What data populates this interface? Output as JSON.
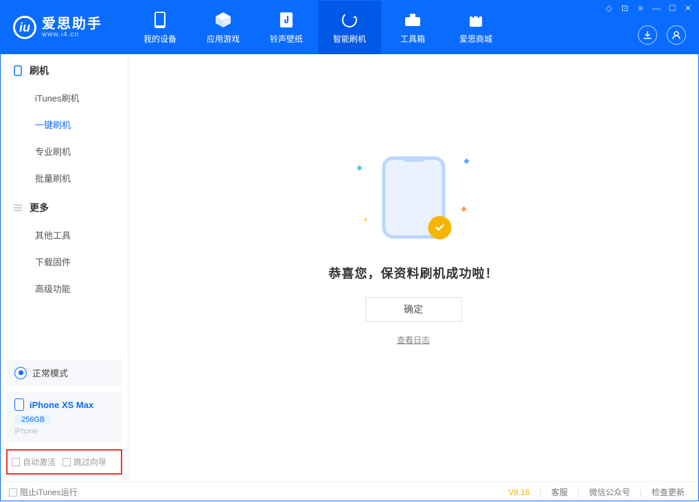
{
  "app": {
    "name_cn": "爱思助手",
    "name_en": "www.i4.cn"
  },
  "nav": {
    "my_device": "我的设备",
    "apps_games": "应用游戏",
    "ringtones": "铃声壁纸",
    "smart_flash": "智能刷机",
    "toolbox": "工具箱",
    "store": "爱思商城"
  },
  "sidebar": {
    "group_flash_title": "刷机",
    "items_flash": {
      "itunes": "iTunes刷机",
      "oneclick": "一键刷机",
      "pro": "专业刷机",
      "batch": "批量刷机"
    },
    "group_more_title": "更多",
    "items_more": {
      "other": "其他工具",
      "download_fw": "下载固件",
      "advanced": "高级功能"
    },
    "mode": "正常模式",
    "device": {
      "name": "iPhone XS Max",
      "capacity": "256GB",
      "type": "iPhone"
    },
    "checkboxes": {
      "auto_activate": "自动激活",
      "skip_wizard": "跳过向导"
    }
  },
  "main": {
    "success_text": "恭喜您，保资料刷机成功啦！",
    "confirm": "确定",
    "view_log": "查看日志"
  },
  "footer": {
    "block_itunes": "阻止iTunes运行",
    "version": "V8.16",
    "support": "客服",
    "wechat": "微信公众号",
    "check_update": "检查更新"
  }
}
